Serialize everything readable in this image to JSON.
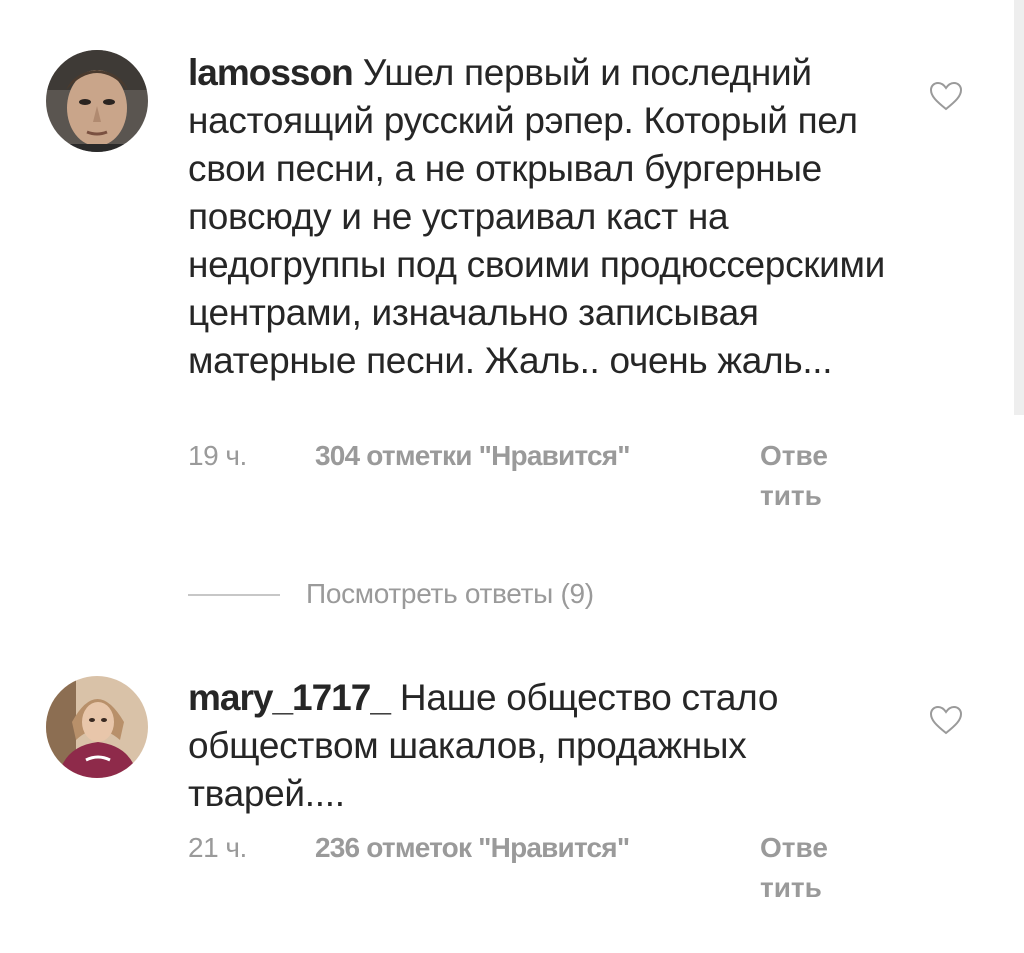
{
  "comments": [
    {
      "avatar": "male-avatar-photo",
      "username": "lamosson",
      "text": "Ушел первый и последний настоящий русский рэпер. Который пел свои песни, а не открывал бургерные повсюду и не устраивал каст на недогруппы под своими продюссерскими центрами, изначально записывая матерные песни. Жаль.. очень жаль...",
      "time": "19 ч.",
      "likes": "304 отметки \"Нравится\"",
      "reply_label": "Ответить",
      "like_icon": "heart-outline-icon"
    },
    {
      "avatar": "female-avatar-photo",
      "username": "mary_1717_",
      "text": "Наше общество стало обществом шакалов, продажных тварей....",
      "time": "21 ч.",
      "likes": "236 отметок \"Нравится\"",
      "reply_label": "Ответить",
      "like_icon": "heart-outline-icon"
    }
  ],
  "view_replies": {
    "label": "Посмотреть ответы (9)"
  },
  "colors": {
    "text": "#262626",
    "secondary": "#9a9a9a",
    "divider": "#c7c7c7"
  }
}
